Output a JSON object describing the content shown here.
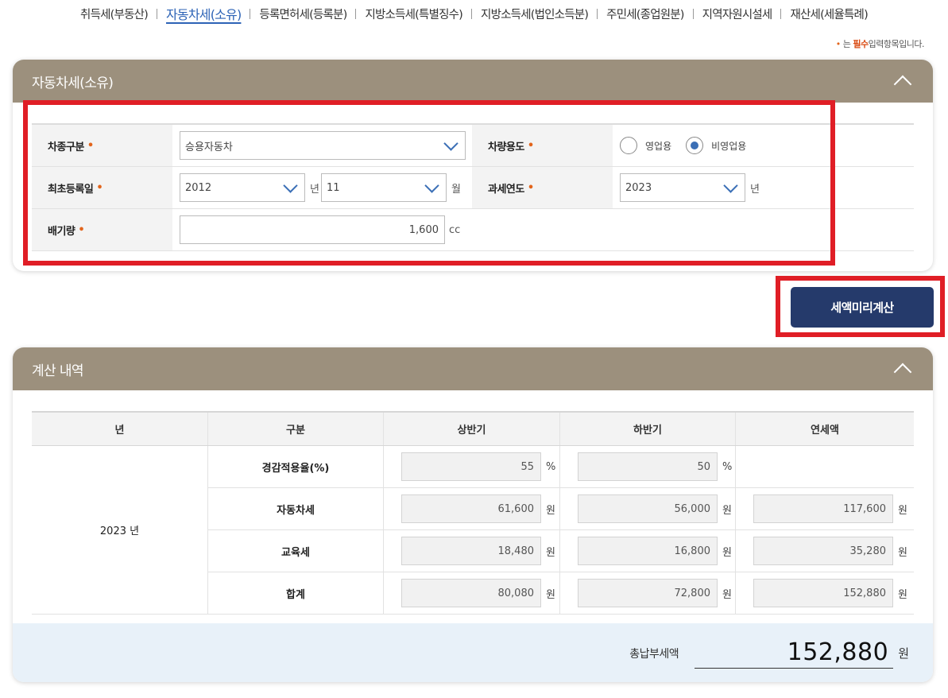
{
  "tabs": [
    {
      "label": "취득세(부동산)",
      "active": false
    },
    {
      "label": "자동차세(소유)",
      "active": true
    },
    {
      "label": "등록면허세(등록분)",
      "active": false
    },
    {
      "label": "지방소득세(특별징수)",
      "active": false
    },
    {
      "label": "지방소득세(법인소득분)",
      "active": false
    },
    {
      "label": "주민세(종업원분)",
      "active": false
    },
    {
      "label": "지역자원시설세",
      "active": false
    },
    {
      "label": "재산세(세율특례)",
      "active": false
    }
  ],
  "required_note": {
    "dot": "•",
    "pre": "는",
    "strong": "필수",
    "post": "입력항목입니다."
  },
  "form_panel": {
    "title": "자동차세(소유)",
    "vehicle_type": {
      "label": "차종구분",
      "req": "•",
      "value": "승용자동차"
    },
    "vehicle_use": {
      "label": "차량용도",
      "req": "•",
      "option1": "영업용",
      "option2": "비영업용",
      "selected": "비영업용"
    },
    "first_reg": {
      "label": "최초등록일",
      "req": "•",
      "year": "2012",
      "year_unit": "년",
      "month": "11",
      "month_unit": "월"
    },
    "tax_year": {
      "label": "과세연도",
      "req": "•",
      "value": "2023",
      "unit": "년"
    },
    "displacement": {
      "label": "배기량",
      "req": "•",
      "value": "1,600",
      "unit": "cc"
    }
  },
  "calc_button": "세액미리계산",
  "result_panel": {
    "title": "계산 내역",
    "headers": [
      "년",
      "구분",
      "상반기",
      "하반기",
      "연세액"
    ],
    "year": "2023 년",
    "rows": [
      {
        "label": "경감적용율(%)",
        "h1": "55",
        "h1_unit": "%",
        "h2": "50",
        "h2_unit": "%",
        "annual": "",
        "annual_unit": ""
      },
      {
        "label": "자동차세",
        "h1": "61,600",
        "h1_unit": "원",
        "h2": "56,000",
        "h2_unit": "원",
        "annual": "117,600",
        "annual_unit": "원"
      },
      {
        "label": "교육세",
        "h1": "18,480",
        "h1_unit": "원",
        "h2": "16,800",
        "h2_unit": "원",
        "annual": "35,280",
        "annual_unit": "원"
      },
      {
        "label": "합계",
        "h1": "80,080",
        "h1_unit": "원",
        "h2": "72,800",
        "h2_unit": "원",
        "annual": "152,880",
        "annual_unit": "원"
      }
    ],
    "total_label": "총납부세액",
    "total_value": "152,880",
    "total_unit": "원"
  },
  "colors": {
    "panel_header": "#9c907d",
    "accent_blue": "#2d63b6",
    "button": "#253a6b",
    "highlight": "#e01e26",
    "required": "#e2641b"
  }
}
